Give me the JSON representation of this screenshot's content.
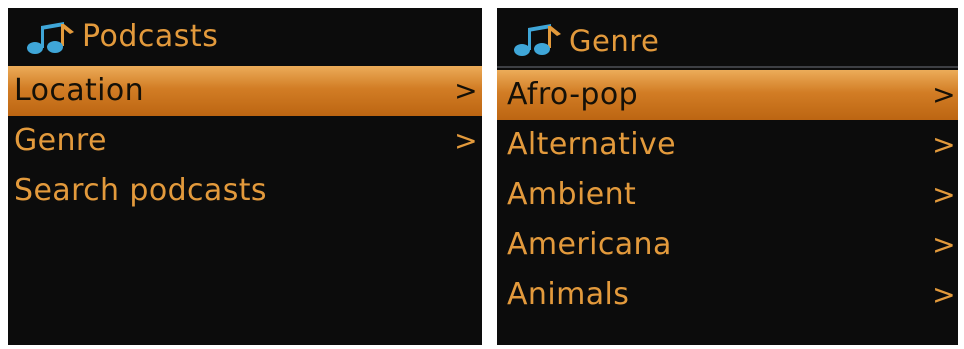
{
  "left_screen": {
    "title": "Podcasts",
    "icon": "music-note-icon",
    "items": [
      {
        "label": "Location",
        "chevron": ">",
        "selected": true
      },
      {
        "label": "Genre",
        "chevron": ">",
        "selected": false
      },
      {
        "label": "Search podcasts",
        "chevron": "",
        "selected": false
      }
    ]
  },
  "right_screen": {
    "title": "Genre",
    "icon": "music-note-icon",
    "items": [
      {
        "label": "Afro-pop",
        "chevron": ">",
        "selected": true
      },
      {
        "label": "Alternative",
        "chevron": ">",
        "selected": false
      },
      {
        "label": "Ambient",
        "chevron": ">",
        "selected": false
      },
      {
        "label": "Americana",
        "chevron": ">",
        "selected": false
      },
      {
        "label": "Animals",
        "chevron": ">",
        "selected": false
      }
    ]
  },
  "colors": {
    "screen_background": "#0c0c0c",
    "menu_text": "#e39a3c",
    "highlight": "#d27d25",
    "icon_note_blue": "#3fa6d8",
    "icon_note_orange": "#e39a3c"
  }
}
